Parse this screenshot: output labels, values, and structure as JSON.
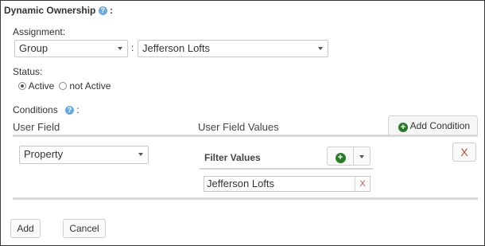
{
  "dynamic_ownership": {
    "title": "Dynamic Ownership",
    "suffix": ":"
  },
  "assignment": {
    "label": "Assignment:",
    "type_value": "Group",
    "separator": ":",
    "group_value": "Jefferson Lofts"
  },
  "status": {
    "label": "Status:",
    "options": [
      {
        "label": "Active",
        "selected": true
      },
      {
        "label": "not Active",
        "selected": false
      }
    ]
  },
  "conditions": {
    "label": "Conditions",
    "suffix": ":",
    "col_user_field": "User Field",
    "col_user_field_values": "User Field Values",
    "add_condition_label": "Add Condition",
    "row": {
      "user_field_value": "Property",
      "filter_values_label": "Filter Values",
      "filter_value": "Jefferson Lofts",
      "remove_filter_label": "X",
      "remove_row_label": "X"
    }
  },
  "footer": {
    "add_label": "Add",
    "cancel_label": "Cancel"
  },
  "colors": {
    "help_icon": "#6fa7d8",
    "plus_icon": "#2a7a2a",
    "remove_x": "#b24a3a"
  }
}
